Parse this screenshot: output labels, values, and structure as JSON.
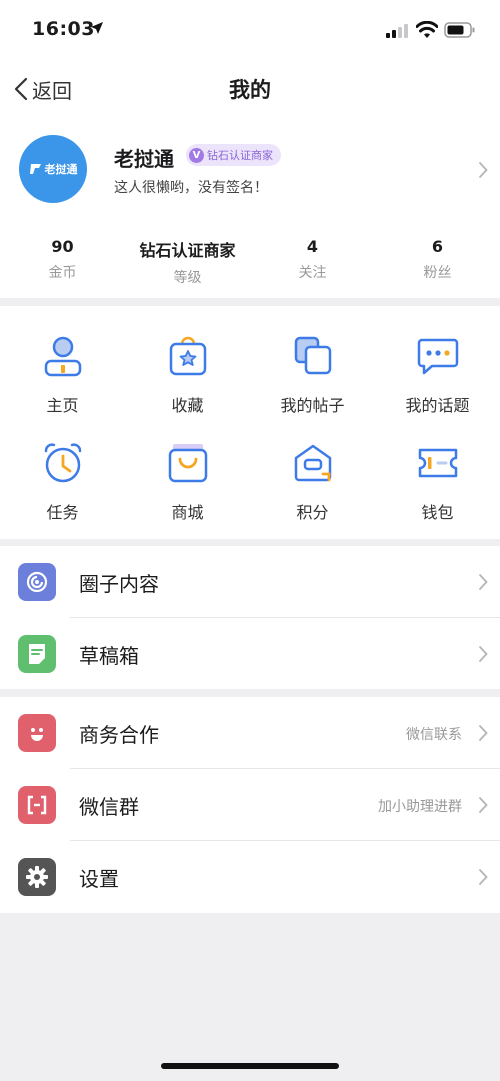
{
  "status_bar": {
    "time": "16:03"
  },
  "nav": {
    "back_label": "返回",
    "title": "我的"
  },
  "profile": {
    "avatar_text": "老挝通",
    "name": "老挝通",
    "badge_letter": "V",
    "badge_text": "钻石认证商家",
    "signature": "这人很懒哟，没有签名！",
    "stats": [
      {
        "value": "90",
        "label": "金币"
      },
      {
        "value": "钻石认证商家",
        "label": "等级"
      },
      {
        "value": "4",
        "label": "关注"
      },
      {
        "value": "6",
        "label": "粉丝"
      }
    ]
  },
  "grid": {
    "items": [
      {
        "label": "主页",
        "icon": "person-icon"
      },
      {
        "label": "收藏",
        "icon": "bag-star-icon"
      },
      {
        "label": "我的帖子",
        "icon": "copy-icon"
      },
      {
        "label": "我的话题",
        "icon": "chat-bubble-icon"
      },
      {
        "label": "任务",
        "icon": "alarm-clock-icon"
      },
      {
        "label": "商城",
        "icon": "shopping-bag-icon"
      },
      {
        "label": "积分",
        "icon": "points-icon"
      },
      {
        "label": "钱包",
        "icon": "ticket-icon"
      }
    ]
  },
  "list1": [
    {
      "label": "圈子内容",
      "icon": "circle-icon",
      "color": "#6b7fdb"
    },
    {
      "label": "草稿箱",
      "icon": "draft-icon",
      "color": "#5fbf6e"
    }
  ],
  "list2": [
    {
      "label": "商务合作",
      "hint": "微信联系",
      "icon": "smile-icon",
      "color": "#e0616c"
    },
    {
      "label": "微信群",
      "hint": "加小助理进群",
      "icon": "bracket-icon",
      "color": "#e0616c"
    },
    {
      "label": "设置",
      "hint": "",
      "icon": "gear-icon",
      "color": "#555555"
    }
  ],
  "colors": {
    "accent_blue": "#3d7be8",
    "accent_orange": "#f5a623"
  }
}
